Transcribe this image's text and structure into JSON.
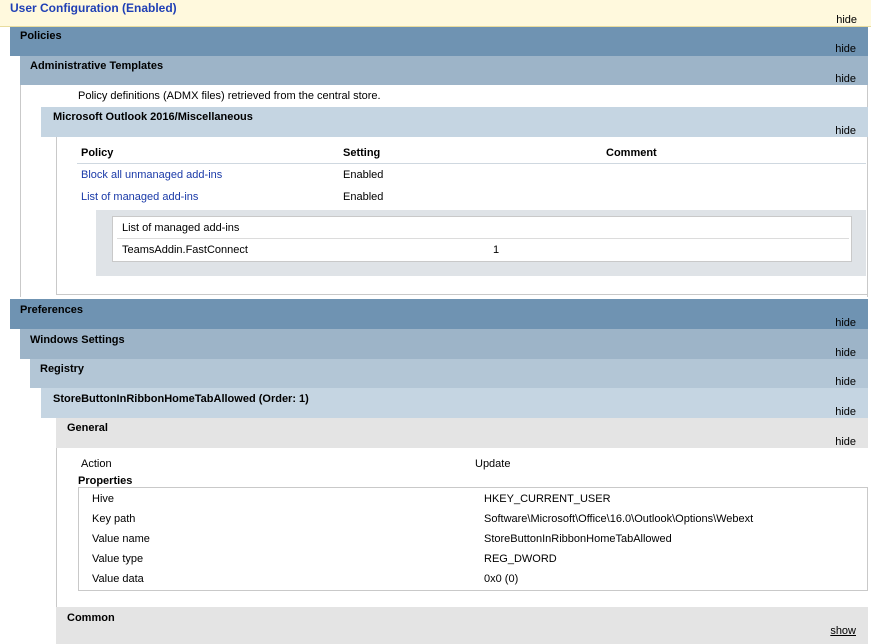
{
  "user_config": {
    "title": "User Configuration (Enabled)",
    "toggle": "hide"
  },
  "policies": {
    "title": "Policies",
    "toggle": "hide"
  },
  "admin_templates": {
    "title": "Administrative Templates",
    "toggle": "hide",
    "note": "Policy definitions (ADMX files) retrieved from the central store."
  },
  "outlook_misc": {
    "title": "Microsoft Outlook 2016/Miscellaneous",
    "toggle": "hide",
    "headers": [
      "Policy",
      "Setting",
      "Comment"
    ],
    "rows": [
      {
        "policy": "Block all unmanaged add-ins",
        "setting": "Enabled",
        "comment": ""
      },
      {
        "policy": "List of managed add-ins",
        "setting": "Enabled",
        "comment": ""
      }
    ],
    "managed_list": {
      "title": "List of managed add-ins",
      "items": [
        {
          "name": "TeamsAddin.FastConnect",
          "value": "1"
        }
      ]
    }
  },
  "preferences": {
    "title": "Preferences",
    "toggle": "hide"
  },
  "windows_settings": {
    "title": "Windows Settings",
    "toggle": "hide"
  },
  "registry": {
    "title": "Registry",
    "toggle": "hide"
  },
  "store_button": {
    "title": "StoreButtonInRibbonHomeTabAllowed (Order: 1)",
    "toggle": "hide"
  },
  "general": {
    "title": "General",
    "toggle": "hide",
    "action_label": "Action",
    "action_value": "Update",
    "properties_label": "Properties",
    "properties": [
      {
        "name": "Hive",
        "value": "HKEY_CURRENT_USER"
      },
      {
        "name": "Key path",
        "value": "Software\\Microsoft\\Office\\16.0\\Outlook\\Options\\Webext"
      },
      {
        "name": "Value name",
        "value": "StoreButtonInRibbonHomeTabAllowed"
      },
      {
        "name": "Value type",
        "value": "REG_DWORD"
      },
      {
        "name": "Value data",
        "value": "0x0 (0)"
      }
    ]
  },
  "common": {
    "title": "Common",
    "toggle": "show"
  },
  "colors": {
    "link": "#1a3aa8",
    "title_link": "#1f3fb5",
    "policies_band": "#6f93b2",
    "admin_band": "#9db4c8",
    "misc_band": "#c5d5e2",
    "general_band": "#e4e4e4"
  }
}
